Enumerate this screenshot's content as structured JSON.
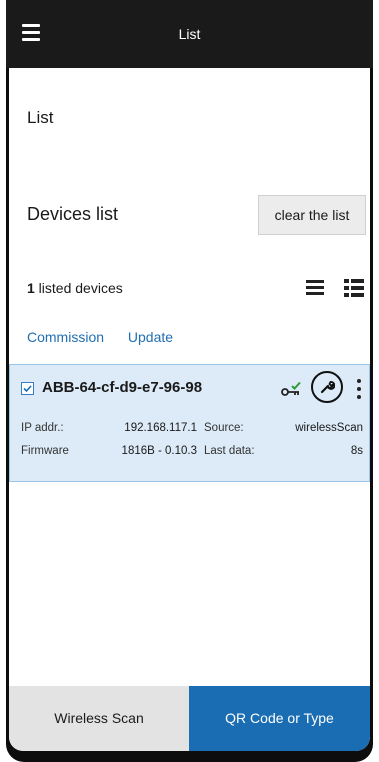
{
  "header": {
    "title": "List",
    "menu_icon": "hamburger-menu-icon"
  },
  "page": {
    "title": "List"
  },
  "devices_section": {
    "title": "Devices list",
    "clear_button": "clear the list",
    "count": "1",
    "count_suffix": " listed devices",
    "view_list_icon": "list-view-icon",
    "view_table_icon": "table-view-icon"
  },
  "actions": {
    "commission": "Commission",
    "update": "Update"
  },
  "device": {
    "name": "ABB-64-cf-d9-e7-96-98",
    "checked": true,
    "ip_label": "IP addr.:",
    "ip_value": "192.168.117.1",
    "source_label": "Source:",
    "source_value": "wirelessScan",
    "firmware_label": "Firmware",
    "firmware_value": "1816B - 0.10.3",
    "last_data_label": "Last data:",
    "last_data_value": "8s"
  },
  "bottom_tabs": {
    "wireless": "Wireless Scan",
    "qr": "QR Code or Type"
  },
  "colors": {
    "accent": "#1b6db3",
    "card_bg": "#dcebf7",
    "key_check": "#2e9a3a"
  }
}
